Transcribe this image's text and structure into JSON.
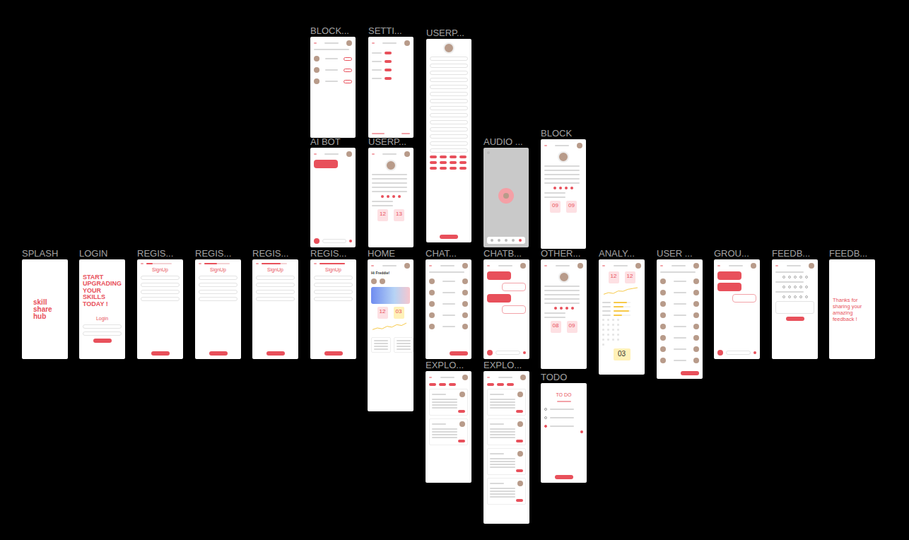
{
  "frames": [
    {
      "label": "BLOCK...",
      "kind": "list"
    },
    {
      "label": "SETTI...",
      "kind": "settings"
    },
    {
      "label": "USERP...",
      "kind": "form"
    },
    {
      "label": "AI BOT",
      "kind": "chat",
      "bubbles": [
        {
          "kind": "in"
        }
      ]
    },
    {
      "label": "USERP...",
      "kind": "profile",
      "stats": [
        {
          "value": "12",
          "color": "#fde0e3"
        },
        {
          "value": "13",
          "color": "#fde0e3"
        }
      ]
    },
    {
      "label": "AUDIO ...",
      "kind": "audio"
    },
    {
      "label": "BLOCK",
      "kind": "profile",
      "stats": [
        {
          "value": "09",
          "color": "#fde0e3"
        },
        {
          "value": "09",
          "color": "#fde0e3"
        }
      ]
    },
    {
      "label": "SPLASH",
      "kind": "splash",
      "logo": [
        "skill",
        "share",
        "hub"
      ]
    },
    {
      "label": "LOGIN",
      "kind": "login",
      "headline": [
        "START",
        "UPGRADING",
        "YOUR SKILLS",
        "TODAY !"
      ],
      "title": "Login"
    },
    {
      "label": "REGIS...",
      "kind": "signup",
      "title": "SignUp",
      "level": 0.25
    },
    {
      "label": "REGIS...",
      "kind": "signup",
      "title": "SignUp",
      "level": 0.5
    },
    {
      "label": "REGIS...",
      "kind": "signup",
      "title": "SignUp",
      "level": 0.75
    },
    {
      "label": "REGIS...",
      "kind": "signup",
      "title": "SignUp",
      "level": 1
    },
    {
      "label": "HOME",
      "kind": "home",
      "greeting": "Hi Freddie!",
      "stats": [
        {
          "value": "12",
          "color": "#fde0e3"
        },
        {
          "value": "03",
          "color": "#fff1b8"
        }
      ],
      "chart": [
        2,
        3,
        2.5,
        4,
        3.5,
        5,
        4.5,
        6
      ]
    },
    {
      "label": "CHAT...",
      "kind": "list"
    },
    {
      "label": "CHATB...",
      "kind": "chat",
      "bubbles": [
        {
          "kind": "in"
        },
        {
          "kind": "out"
        },
        {
          "kind": "in"
        },
        {
          "kind": "out"
        }
      ]
    },
    {
      "label": "OTHER...",
      "kind": "profile",
      "stats": [
        {
          "value": "08",
          "color": "#fde0e3"
        },
        {
          "value": "09",
          "color": "#fde0e3"
        }
      ]
    },
    {
      "label": "ANALY...",
      "kind": "analytics",
      "stats": [
        {
          "value": "12",
          "color": "#fde0e3"
        },
        {
          "value": "12",
          "color": "#fde0e3"
        }
      ],
      "total": "03",
      "chart": [
        2,
        3,
        2.5,
        4,
        3.8,
        5,
        5.5,
        6
      ],
      "bars": [
        0.8,
        0.6,
        0.9,
        0.5
      ]
    },
    {
      "label": "USER ...",
      "kind": "list"
    },
    {
      "label": "GROU...",
      "kind": "chat",
      "bubbles": [
        {
          "kind": "in"
        },
        {
          "kind": "in"
        },
        {
          "kind": "out"
        }
      ]
    },
    {
      "label": "FEEDB...",
      "kind": "feedback",
      "ratings": [
        {
          "stars": 0
        },
        {
          "stars": 0
        },
        {
          "stars": 0
        }
      ]
    },
    {
      "label": "FEEDB...",
      "kind": "thanks",
      "text": "Thanks for sharing your amazing feedback !"
    },
    {
      "label": "EXPLO...",
      "kind": "explore"
    },
    {
      "label": "EXPLO...",
      "kind": "explore"
    },
    {
      "label": "TODO",
      "kind": "todo",
      "title": "TO DO",
      "items": [
        {
          "checked": false
        },
        {
          "checked": false
        },
        {
          "checked": true
        }
      ]
    }
  ]
}
